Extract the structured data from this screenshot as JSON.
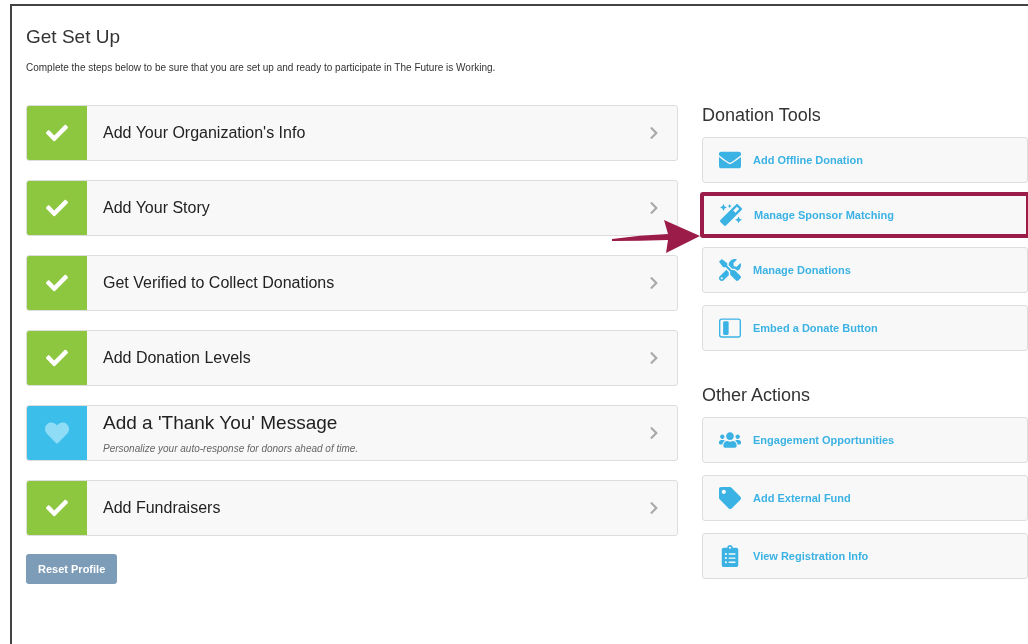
{
  "title": "Get Set Up",
  "subtitle": "Complete the steps below to be sure that you are set up and ready to participate in The Future is Working.",
  "steps": [
    {
      "label": "Add Your Organization's Info",
      "completed": true
    },
    {
      "label": "Add Your Story",
      "completed": true
    },
    {
      "label": "Get Verified to Collect Donations",
      "completed": true
    },
    {
      "label": "Add Donation Levels",
      "completed": true
    },
    {
      "label": "Add a 'Thank You' Message",
      "description": "Personalize your auto-response for donors ahead of time.",
      "completed": false
    },
    {
      "label": "Add Fundraisers",
      "completed": true
    }
  ],
  "reset_button": "Reset Profile",
  "sections": [
    {
      "title": "Donation Tools",
      "items": [
        {
          "label": "Add Offline Donation",
          "kind": "envelope",
          "highlighted": false
        },
        {
          "label": "Manage Sponsor Matching",
          "kind": "wand",
          "highlighted": true
        },
        {
          "label": "Manage Donations",
          "kind": "tools",
          "highlighted": false
        },
        {
          "label": "Embed a Donate Button",
          "kind": "embed",
          "highlighted": false
        }
      ]
    },
    {
      "title": "Other Actions",
      "items": [
        {
          "label": "Engagement Opportunities",
          "kind": "users",
          "highlighted": false
        },
        {
          "label": "Add External Fund",
          "kind": "tag",
          "highlighted": false
        },
        {
          "label": "View Registration Info",
          "kind": "clipboard",
          "highlighted": false
        }
      ]
    }
  ]
}
